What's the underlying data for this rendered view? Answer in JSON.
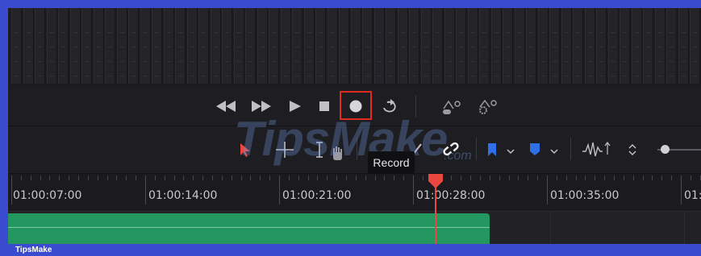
{
  "meters": {
    "count": 59
  },
  "transport": {
    "rewind": "rewind",
    "fast_forward": "fast-forward",
    "play": "play",
    "stop": "stop",
    "record": "record",
    "loop": "loop"
  },
  "tooltip": {
    "text": "Record"
  },
  "watermark": {
    "brand": "TipsMake",
    "suffix": ".com"
  },
  "timeline": {
    "timecodes": [
      "01:00:07:00",
      "01:00:14:00",
      "01:00:21:00",
      "01:00:28:00",
      "01:00:35:00",
      "01:"
    ]
  },
  "footer": {
    "brand": "TipsMake"
  },
  "colors": {
    "accent_blue": "#3a4bd0",
    "clip_green": "#23975f",
    "playhead_red": "#e8463e",
    "highlight_red": "#e02b20",
    "flag_blue": "#2f6fe8"
  }
}
